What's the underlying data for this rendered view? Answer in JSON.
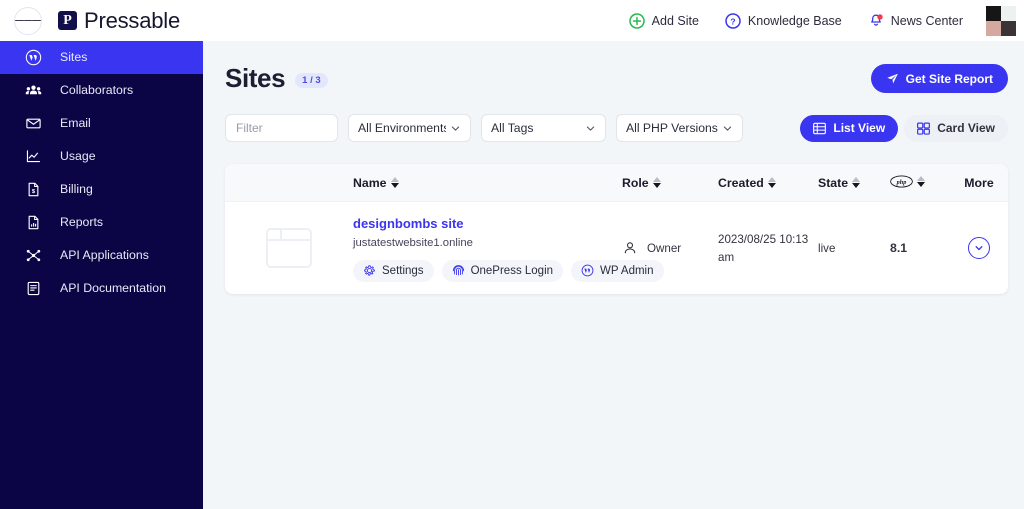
{
  "topbar": {
    "menu_icon": "hamburger-icon",
    "brand_mark": "P",
    "brand_name": "Pressable",
    "nav": [
      {
        "label": "Add Site",
        "icon": "plus-circle-icon"
      },
      {
        "label": "Knowledge Base",
        "icon": "question-circle-icon"
      },
      {
        "label": "News Center",
        "icon": "bell-icon"
      }
    ]
  },
  "sidebar": {
    "items": [
      {
        "label": "Sites",
        "icon": "wordpress-icon",
        "active": true
      },
      {
        "label": "Collaborators",
        "icon": "users-icon",
        "active": false
      },
      {
        "label": "Email",
        "icon": "envelope-icon",
        "active": false
      },
      {
        "label": "Usage",
        "icon": "chart-line-icon",
        "active": false
      },
      {
        "label": "Billing",
        "icon": "invoice-dollar-icon",
        "active": false
      },
      {
        "label": "Reports",
        "icon": "file-chart-icon",
        "active": false
      },
      {
        "label": "API Applications",
        "icon": "nodes-icon",
        "active": false
      },
      {
        "label": "API Documentation",
        "icon": "book-icon",
        "active": false
      }
    ]
  },
  "page": {
    "title": "Sites",
    "count_badge": "1 / 3",
    "report_button": {
      "label": "Get Site Report",
      "icon": "send-icon"
    }
  },
  "filters": {
    "search_placeholder": "Filter",
    "search_value": "",
    "environments": "All Environments",
    "tags": "All Tags",
    "php_versions": "All PHP Versions"
  },
  "view": {
    "list": {
      "label": "List View",
      "icon": "list-view-icon",
      "active": true
    },
    "card": {
      "label": "Card View",
      "icon": "card-view-icon",
      "active": false
    }
  },
  "table": {
    "headers": {
      "name": "Name",
      "role": "Role",
      "created": "Created",
      "state": "State",
      "php": "php",
      "more": "More"
    },
    "rows": [
      {
        "site_name": "designbombs site",
        "site_url": "justatestwebsite1.online",
        "actions": [
          {
            "label": "Settings",
            "icon": "gear-icon"
          },
          {
            "label": "OnePress Login",
            "icon": "fingerprint-icon"
          },
          {
            "label": "WP Admin",
            "icon": "wordpress-icon"
          }
        ],
        "role": "Owner",
        "created": "2023/08/25 10:13 am",
        "state": "live",
        "php": "8.1"
      }
    ]
  },
  "colors": {
    "accent": "#3a35f0",
    "sidebar_bg": "#0b0546",
    "page_bg": "#f2f6f9",
    "add_site_green": "#29b852",
    "alert_red": "#f03a4e"
  }
}
